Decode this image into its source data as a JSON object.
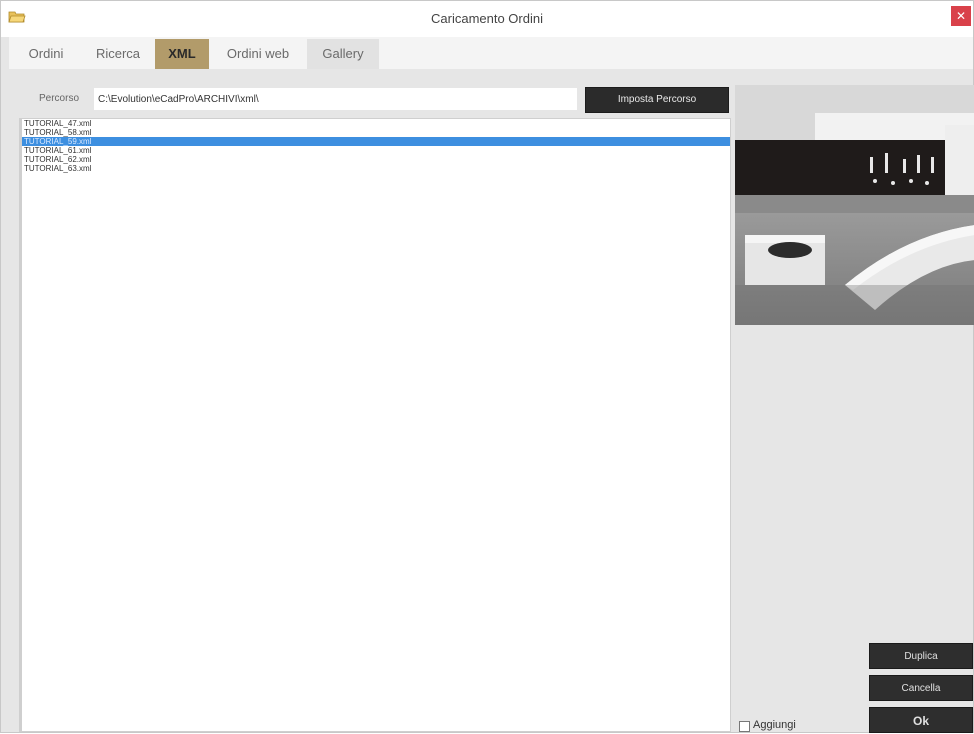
{
  "window": {
    "title": "Caricamento Ordini",
    "close_glyph": "✕"
  },
  "tabs": [
    {
      "label": "Ordini",
      "active": false
    },
    {
      "label": "Ricerca",
      "active": false
    },
    {
      "label": "XML",
      "active": true
    },
    {
      "label": "Ordini web",
      "active": false
    },
    {
      "label": "Gallery",
      "active": false
    }
  ],
  "path": {
    "label": "Percorso",
    "value": "C:\\Evolution\\eCadPro\\ARCHIVI\\xml\\",
    "button_label": "Imposta Percorso"
  },
  "files": [
    {
      "name": "TUTORIAL_47.xml",
      "selected": false
    },
    {
      "name": "TUTORIAL_58.xml",
      "selected": false
    },
    {
      "name": "TUTORIAL_59.xml",
      "selected": true
    },
    {
      "name": "TUTORIAL_61.xml",
      "selected": false
    },
    {
      "name": "TUTORIAL_62.xml",
      "selected": false
    },
    {
      "name": "TUTORIAL_63.xml",
      "selected": false
    }
  ],
  "actions": {
    "duplicate_label": "Duplica",
    "delete_label": "Cancella",
    "ok_label": "Ok",
    "append_label": "Aggiungi",
    "append_checked": false
  },
  "colors": {
    "active_tab": "#b29b6a",
    "selection": "#3d8fe0",
    "dark_button": "#2e2e2e",
    "close": "#d9414a"
  },
  "icons": {
    "app": "folder-open-icon",
    "close": "close-icon"
  }
}
